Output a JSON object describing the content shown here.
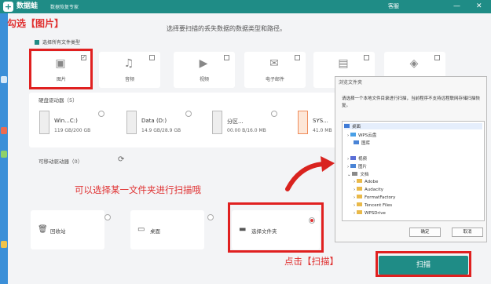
{
  "app": {
    "name": "数据蛙",
    "subtitle": "数据恢复专家",
    "service": "客服",
    "min_icon": "minimize-icon",
    "close_icon": "close-icon"
  },
  "instruction": "选择要扫描的丢失数据的数据类型和路径。",
  "select_all": "选择所有文件类型",
  "file_types": [
    {
      "label": "图片",
      "icon": "image-icon",
      "checked": true
    },
    {
      "label": "音频",
      "icon": "audio-icon",
      "checked": false
    },
    {
      "label": "视频",
      "icon": "video-icon",
      "checked": false
    },
    {
      "label": "电子邮件",
      "icon": "email-icon",
      "checked": false
    },
    {
      "label": "",
      "icon": "document-icon",
      "checked": false
    },
    {
      "label": "",
      "icon": "other-icon",
      "checked": false
    }
  ],
  "drives_section": "硬盘驱动器（5）",
  "drives": [
    {
      "name": "Win...C:)",
      "size": "119 GB/200 GB"
    },
    {
      "name": "Data (D:)",
      "size": "14.9 GB/28.9 GB"
    },
    {
      "name": "分区...",
      "size": "00.00 B/16.0 MB"
    },
    {
      "name": "SYS...",
      "size": "41.0 MB"
    }
  ],
  "removable_section": "可移动驱动器（0）",
  "locations": [
    {
      "label": "回收站",
      "icon": "recycle-bin-icon"
    },
    {
      "label": "桌面",
      "icon": "desktop-icon"
    },
    {
      "label": "选择文件夹",
      "icon": "folder-icon"
    }
  ],
  "annotations": {
    "pick": "勾选【图片】",
    "folder": "可以选择某一文件夹进行扫描哦",
    "click": "点击【扫描】"
  },
  "dialog": {
    "title": "浏览文件夹",
    "message": "请选择一个本地文件目录进行扫描，当前程序不支持远程联网存储扫描恢复。",
    "tree": [
      "桌面",
      "WPS云盘",
      "图库",
      "视频",
      "图片",
      "文档",
      "Adobe",
      "Audacity",
      "FormatFactory",
      "Tencent Files",
      "WPSDrive"
    ],
    "ok": "确定",
    "cancel": "取消"
  },
  "scan_button": "扫描",
  "colors": {
    "accent": "#1f8c86",
    "annotation": "#e03131"
  }
}
